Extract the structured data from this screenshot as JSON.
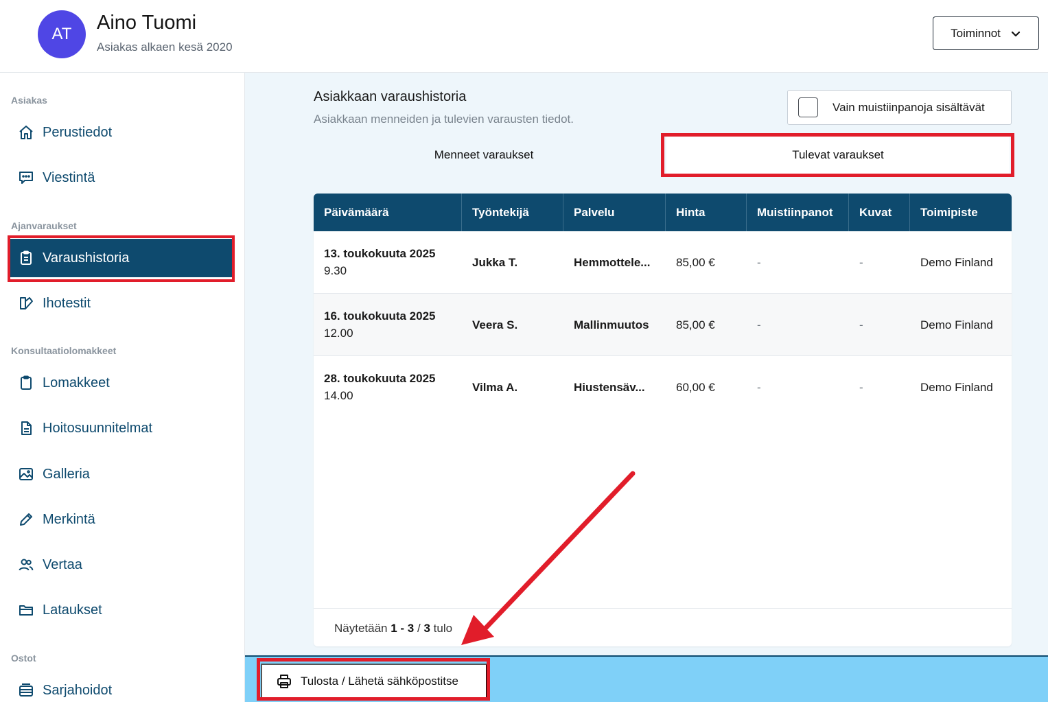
{
  "header": {
    "avatar_initials": "AT",
    "customer_name": "Aino Tuomi",
    "customer_since": "Asiakas alkaen kesä 2020",
    "actions_label": "Toiminnot"
  },
  "sidebar": {
    "sections": [
      {
        "title": "Asiakas"
      },
      {
        "title": "Ajanvaraukset"
      },
      {
        "title": "Konsultaatiolomakkeet"
      },
      {
        "title": "Ostot"
      }
    ],
    "items": [
      {
        "label": "Perustiedot",
        "icon": "home-icon"
      },
      {
        "label": "Viestintä",
        "icon": "chat-icon"
      },
      {
        "label": "Varaushistoria",
        "icon": "clipboard-list-icon",
        "active": true
      },
      {
        "label": "Ihotestit",
        "icon": "skin-test-icon"
      },
      {
        "label": "Lomakkeet",
        "icon": "clipboard-icon"
      },
      {
        "label": "Hoitosuunnitelmat",
        "icon": "document-icon"
      },
      {
        "label": "Galleria",
        "icon": "image-icon"
      },
      {
        "label": "Merkintä",
        "icon": "pencil-icon"
      },
      {
        "label": "Vertaa",
        "icon": "users-icon"
      },
      {
        "label": "Lataukset",
        "icon": "folder-icon"
      },
      {
        "label": "Sarjahoidot",
        "icon": "stack-icon"
      }
    ]
  },
  "main": {
    "title": "Asiakkaan varaushistoria",
    "subtitle": "Asiakkaan menneiden ja tulevien varausten tiedot.",
    "filter_label": "Vain muistiinpanoja sisältävät",
    "tabs": [
      {
        "label": "Menneet varaukset"
      },
      {
        "label": "Tulevat varaukset",
        "active": true
      }
    ],
    "table": {
      "columns": [
        "Päivämäärä",
        "Työntekijä",
        "Palvelu",
        "Hinta",
        "Muistiinpanot",
        "Kuvat",
        "Toimipiste"
      ],
      "rows": [
        {
          "date": "13. toukokuuta 2025",
          "time": "9.30",
          "employee": "Jukka T.",
          "service": "Hemmottele...",
          "price": "85,00 €",
          "notes": "-",
          "images": "-",
          "location": "Demo Finland"
        },
        {
          "date": "16. toukokuuta 2025",
          "time": "12.00",
          "employee": "Veera S.",
          "service": "Mallinmuutos",
          "price": "85,00 €",
          "notes": "-",
          "images": "-",
          "location": "Demo Finland"
        },
        {
          "date": "28. toukokuuta 2025",
          "time": "14.00",
          "employee": "Vilma A.",
          "service": "Hiustensäv...",
          "price": "60,00 €",
          "notes": "-",
          "images": "-",
          "location": "Demo Finland"
        }
      ]
    },
    "pager": {
      "prefix": "Näytetään",
      "range": "1 - 3",
      "separator": "/",
      "total": "3",
      "suffix": "tulo"
    }
  },
  "bottom_bar": {
    "print_label": "Tulosta / Lähetä sähköpostitse"
  },
  "colors": {
    "primary": "#0e4a6e",
    "avatar": "#4f46e5",
    "highlight": "#e11d2a",
    "bottom_bar": "#7fd0f8"
  }
}
